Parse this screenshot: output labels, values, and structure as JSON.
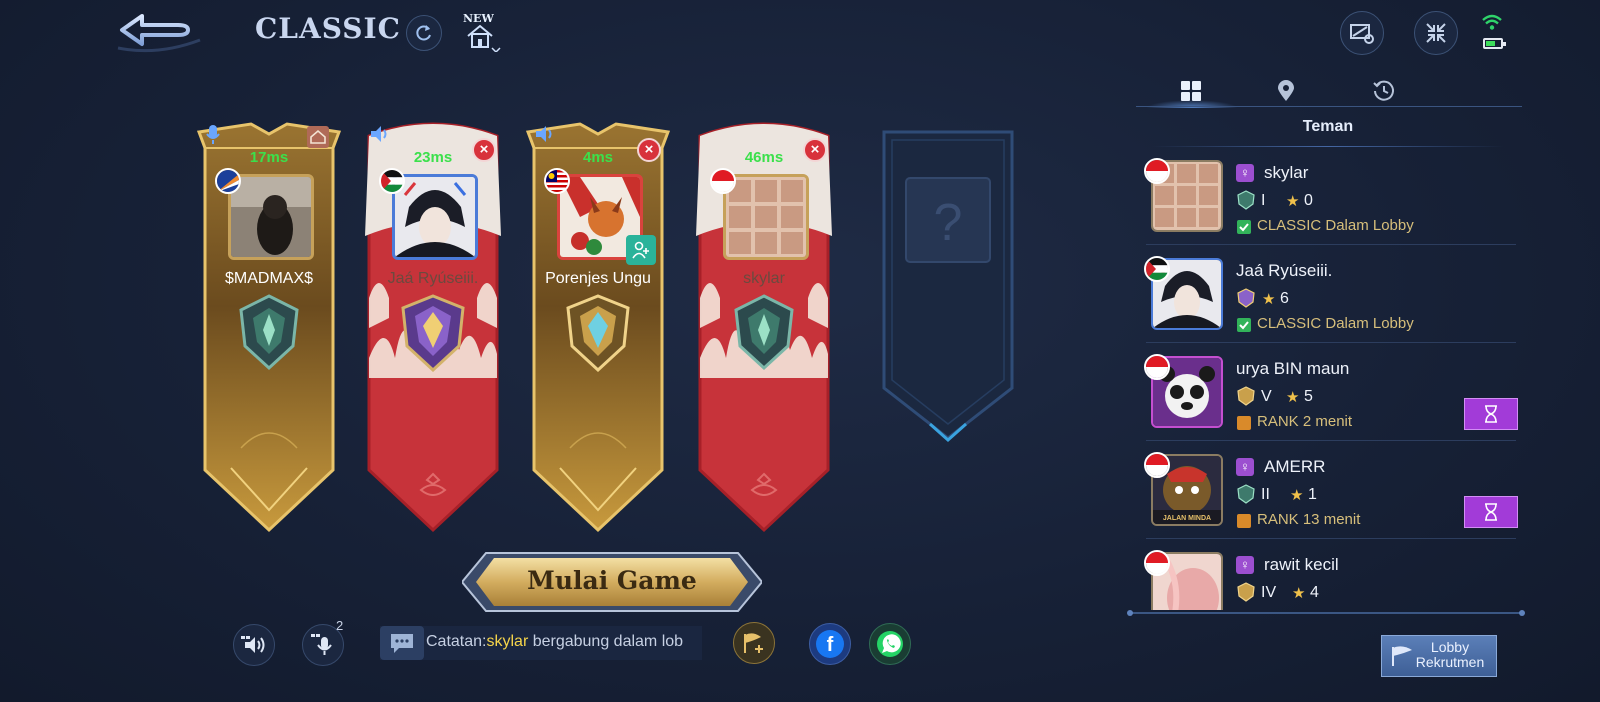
{
  "header": {
    "mode_title": "CLASSIC",
    "new_tag": "NEW"
  },
  "players": [
    {
      "name": "$MADMAX$",
      "ping": "17ms",
      "theme": "gold",
      "flag": "marshall"
    },
    {
      "name": "Jaá Ryúseiii.",
      "ping": "23ms",
      "theme": "red",
      "flag": "palestine"
    },
    {
      "name": "Porenjes Ungu",
      "ping": "4ms",
      "theme": "gold",
      "flag": "malaysia"
    },
    {
      "name": "skylar",
      "ping": "46ms",
      "theme": "red",
      "flag": "indonesia"
    }
  ],
  "empty_slot_symbol": "?",
  "start_button": {
    "label": "Mulai Game"
  },
  "chat": {
    "prefix": "Catatan:",
    "highlight": "skylar",
    "message": " bergabung dalam lob"
  },
  "bottom": {
    "mic_count": "2"
  },
  "friends_panel": {
    "title": "Teman",
    "friends": [
      {
        "name": "skylar",
        "gender": "♀",
        "tier": "I",
        "stars": "0",
        "status": "CLASSIC Dalam Lobby",
        "status_type": "lobby"
      },
      {
        "name": "Jaá Ryúseiii.",
        "gender": "",
        "tier": "",
        "stars": "6",
        "status": "CLASSIC Dalam Lobby",
        "status_type": "lobby"
      },
      {
        "name": "urya BIN maun",
        "gender": "",
        "tier": "V",
        "stars": "5",
        "status": "RANK 2 menit",
        "status_type": "rank"
      },
      {
        "name": "AMERR",
        "gender": "♀",
        "tier": "II",
        "stars": "1",
        "status": "RANK 13 menit",
        "status_type": "rank"
      },
      {
        "name": "rawit kecil",
        "gender": "♀",
        "tier": "IV",
        "stars": "4",
        "status": "",
        "status_type": "none"
      }
    ],
    "avatar_text_amerr": "JALAN MINDA"
  },
  "lobby_button": {
    "line1": "Lobby",
    "line2": "Rekrutmen"
  },
  "colors": {
    "accent_blue": "#5b7fb8",
    "ping_green": "#3be04b",
    "status_gold": "#d7bf7b",
    "wait_purple": "#a23bd8",
    "close_red": "#d8323b"
  }
}
